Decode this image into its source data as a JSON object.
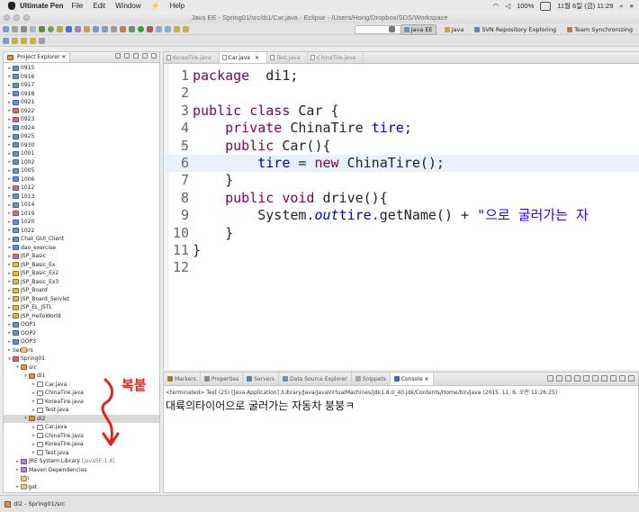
{
  "menubar": {
    "app": "Ultimate Pen",
    "items": [
      "File",
      "Edit",
      "Window",
      "Help"
    ],
    "battery": "100%",
    "datetime": "11월 6일 (금) 11:29"
  },
  "window": {
    "title": "Java EE - Spring01/src/di1/Car.java - Eclipse - /Users/Hong/Dropbox/SDS/Workspace"
  },
  "perspectives": [
    {
      "label": "Java EE",
      "active": true
    },
    {
      "label": "Java",
      "active": false
    },
    {
      "label": "SVN Repository Exploring",
      "active": false
    },
    {
      "label": "Team Synchronizing",
      "active": false
    }
  ],
  "explorer": {
    "title": "Project Explorer",
    "items": [
      {
        "label": "0915",
        "depth": 0,
        "icon": "proj",
        "twisty": "▸"
      },
      {
        "label": "0916",
        "depth": 0,
        "icon": "proj",
        "twisty": "▸"
      },
      {
        "label": "0917",
        "depth": 0,
        "icon": "proj",
        "twisty": "▸"
      },
      {
        "label": "0918",
        "depth": 0,
        "icon": "proj",
        "twisty": "▸"
      },
      {
        "label": "0921",
        "depth": 0,
        "icon": "proj",
        "twisty": "▸"
      },
      {
        "label": "0922",
        "depth": 0,
        "icon": "projx",
        "twisty": "▸"
      },
      {
        "label": "0923",
        "depth": 0,
        "icon": "projx",
        "twisty": "▸"
      },
      {
        "label": "0924",
        "depth": 0,
        "icon": "proj",
        "twisty": "▸"
      },
      {
        "label": "0925",
        "depth": 0,
        "icon": "proj",
        "twisty": "▸"
      },
      {
        "label": "0930",
        "depth": 0,
        "icon": "proj",
        "twisty": "▸"
      },
      {
        "label": "1001",
        "depth": 0,
        "icon": "proj",
        "twisty": "▸"
      },
      {
        "label": "1002",
        "depth": 0,
        "icon": "proj",
        "twisty": "▸"
      },
      {
        "label": "1005",
        "depth": 0,
        "icon": "proj",
        "twisty": "▸"
      },
      {
        "label": "1006",
        "depth": 0,
        "icon": "proj",
        "twisty": "▸"
      },
      {
        "label": "1012",
        "depth": 0,
        "icon": "projx",
        "twisty": "▸"
      },
      {
        "label": "1013",
        "depth": 0,
        "icon": "proj",
        "twisty": "▸"
      },
      {
        "label": "1014",
        "depth": 0,
        "icon": "proj",
        "twisty": "▸"
      },
      {
        "label": "1019",
        "depth": 0,
        "icon": "projx",
        "twisty": "▸"
      },
      {
        "label": "1020",
        "depth": 0,
        "icon": "proj",
        "twisty": "▸"
      },
      {
        "label": "1022",
        "depth": 0,
        "icon": "proj",
        "twisty": "▸"
      },
      {
        "label": "Chat_GUI_Client",
        "depth": 0,
        "icon": "proj",
        "twisty": "▸"
      },
      {
        "label": "dao_exercise",
        "depth": 0,
        "icon": "proj",
        "twisty": "▸"
      },
      {
        "label": "JSP_Basic",
        "depth": 0,
        "icon": "projx",
        "twisty": "▸"
      },
      {
        "label": "JSP_Basic_Ex",
        "depth": 0,
        "icon": "web",
        "twisty": "▸"
      },
      {
        "label": "JSP_Basic_Ex2",
        "depth": 0,
        "icon": "web",
        "twisty": "▸"
      },
      {
        "label": "JSP_Basic_Ex3",
        "depth": 0,
        "icon": "web",
        "twisty": "▸"
      },
      {
        "label": "JSP_Board",
        "depth": 0,
        "icon": "web",
        "twisty": "▸"
      },
      {
        "label": "JSP_Board_Servlet",
        "depth": 0,
        "icon": "web",
        "twisty": "▸"
      },
      {
        "label": "JSP_EL_JSTL",
        "depth": 0,
        "icon": "web",
        "twisty": "▸"
      },
      {
        "label": "JSP_HelloWorld",
        "depth": 0,
        "icon": "web",
        "twisty": "▸"
      },
      {
        "label": "OOP1",
        "depth": 0,
        "icon": "proj",
        "twisty": "▸"
      },
      {
        "label": "OOP2",
        "depth": 0,
        "icon": "proj",
        "twisty": "▸"
      },
      {
        "label": "OOP3",
        "depth": 0,
        "icon": "proj",
        "twisty": "▸"
      },
      {
        "label": "Servers",
        "depth": 0,
        "icon": "fold",
        "twisty": "▸"
      },
      {
        "label": "Spring01",
        "depth": 0,
        "icon": "projx",
        "twisty": "▾"
      },
      {
        "label": "src",
        "depth": 1,
        "icon": "src",
        "twisty": "▾"
      },
      {
        "label": "di1",
        "depth": 2,
        "icon": "pkg",
        "twisty": "▾"
      },
      {
        "label": "Car.java",
        "depth": 3,
        "icon": "java",
        "twisty": "▸"
      },
      {
        "label": "ChinaTire.java",
        "depth": 3,
        "icon": "java",
        "twisty": "▸"
      },
      {
        "label": "KoreaTire.java",
        "depth": 3,
        "icon": "java",
        "twisty": "▸"
      },
      {
        "label": "Test.java",
        "depth": 3,
        "icon": "java",
        "twisty": "▸"
      },
      {
        "label": "di2",
        "depth": 2,
        "icon": "pkg",
        "twisty": "▾",
        "selected": true
      },
      {
        "label": "Car.java",
        "depth": 3,
        "icon": "java",
        "twisty": "▸"
      },
      {
        "label": "ChinaTire.java",
        "depth": 3,
        "icon": "java",
        "twisty": "▸"
      },
      {
        "label": "KoreaTire.java",
        "depth": 3,
        "icon": "java",
        "twisty": "▸"
      },
      {
        "label": "Test.java",
        "depth": 3,
        "icon": "java",
        "twisty": "▸"
      },
      {
        "label": "JRE System Library",
        "extra": "[JavaSE-1.8]",
        "depth": 1,
        "icon": "lib",
        "twisty": "▸"
      },
      {
        "label": "Maven Dependencies",
        "depth": 1,
        "icon": "lib",
        "twisty": "▸"
      },
      {
        "label": "bin",
        "depth": 1,
        "icon": "fold",
        "twisty": ""
      },
      {
        "label": "target",
        "depth": 1,
        "icon": "fold",
        "twisty": "▸"
      }
    ]
  },
  "editor": {
    "tabs": [
      {
        "label": "KoreaTire.java",
        "active": false
      },
      {
        "label": "Car.java",
        "active": true
      },
      {
        "label": "Test.java",
        "active": false
      },
      {
        "label": "ChinaTire.java",
        "active": false
      }
    ],
    "lines": [
      {
        "n": "1",
        "fold": "",
        "hl": false,
        "parts": [
          [
            "kw",
            "package"
          ],
          [
            "",
            "  di1;"
          ]
        ]
      },
      {
        "n": "2",
        "fold": "",
        "hl": false,
        "parts": []
      },
      {
        "n": "3",
        "fold": "",
        "hl": false,
        "parts": [
          [
            "kw",
            "public"
          ],
          [
            "",
            " "
          ],
          [
            "kw",
            "class"
          ],
          [
            "",
            " Car {"
          ]
        ]
      },
      {
        "n": "4",
        "fold": "",
        "hl": false,
        "parts": [
          [
            "",
            "    "
          ],
          [
            "kw",
            "private"
          ],
          [
            "",
            " ChinaTire "
          ],
          [
            "fld",
            "tire"
          ],
          [
            "",
            ";"
          ]
        ]
      },
      {
        "n": "5",
        "fold": "⊖",
        "hl": false,
        "parts": [
          [
            "",
            "    "
          ],
          [
            "kw",
            "public"
          ],
          [
            "",
            " Car(){"
          ]
        ]
      },
      {
        "n": "6",
        "fold": "",
        "hl": true,
        "parts": [
          [
            "",
            "        "
          ],
          [
            "fld",
            "tire"
          ],
          [
            "",
            " = "
          ],
          [
            "kw",
            "new"
          ],
          [
            "",
            " ChinaTire();"
          ]
        ]
      },
      {
        "n": "7",
        "fold": "",
        "hl": false,
        "parts": [
          [
            "",
            "    }"
          ]
        ]
      },
      {
        "n": "8",
        "fold": "⊖",
        "hl": false,
        "parts": [
          [
            "",
            "    "
          ],
          [
            "kw",
            "public"
          ],
          [
            "",
            " "
          ],
          [
            "kw",
            "void"
          ],
          [
            "",
            " drive(){"
          ]
        ]
      },
      {
        "n": "9",
        "fold": "",
        "hl": false,
        "parts": [
          [
            "",
            "        System."
          ],
          [
            "ital",
            "out"
          ],
          [
            ".println("
          ],
          [
            "fld",
            "tire"
          ],
          [
            "",
            ".getName() + "
          ],
          [
            "str",
            "\"으로 굴러가는 자"
          ]
        ]
      },
      {
        "n": "10",
        "fold": "",
        "hl": false,
        "parts": [
          [
            "",
            "    }"
          ]
        ]
      },
      {
        "n": "11",
        "fold": "",
        "hl": false,
        "parts": [
          [
            "",
            "}"
          ]
        ]
      },
      {
        "n": "12",
        "fold": "",
        "hl": false,
        "parts": []
      }
    ]
  },
  "console": {
    "tabs": [
      {
        "label": "Markers",
        "active": false,
        "color": "#9a7a3a"
      },
      {
        "label": "Properties",
        "active": false,
        "color": "#888"
      },
      {
        "label": "Servers",
        "active": false,
        "color": "#5a7fa8"
      },
      {
        "label": "Data Source Explorer",
        "active": false,
        "color": "#6e8fb8"
      },
      {
        "label": "Snippets",
        "active": false,
        "color": "#a8a8a8"
      },
      {
        "label": "Console",
        "active": true,
        "color": "#3b6fb0"
      }
    ],
    "terminated": "<terminated> Test (25) [Java Application] /Library/Java/JavaVirtualMachines/jdk1.8.0_40.jdk/Contents/Home/bin/java (2015. 11. 6. 오전 11:26:25)",
    "output": "대륙의타이어으로 굴러가는 자동차 붕붕ㅋ"
  },
  "status": {
    "text": "di2 - Spring01/src"
  },
  "annotation": {
    "text": "복붙",
    "color": "#e0251a"
  }
}
